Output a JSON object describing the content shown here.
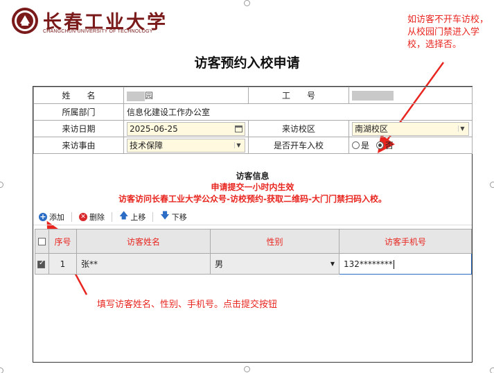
{
  "header": {
    "logo_cn": "长春工业大学",
    "logo_en": "CHANGCHUN UNIVERSITY OF TECHNOLOGY",
    "brand_color": "#7a1a1a"
  },
  "page_title": "访客预约入校申请",
  "annotations": {
    "top_note": "如访客不开车访校，从校园门禁进入学校，选择否。",
    "bottom_note": "填写访客姓名、性别、手机号。点击提交按钮",
    "color": "#e8251f"
  },
  "form": {
    "name_label": "姓　　名",
    "name_value_tail": "园",
    "id_label": "工　　号",
    "dept_label": "所属部门",
    "dept_value": "信息化建设工作办公室",
    "date_label": "来访日期",
    "date_value": "2025-06-25",
    "campus_label": "来访校区",
    "campus_value": "南湖校区",
    "reason_label": "来访事由",
    "reason_value": "技术保障",
    "car_label": "是否开车入校",
    "car_options": {
      "yes": "是",
      "no": "否"
    },
    "car_selected": "no",
    "input_bg": "#fff9e0"
  },
  "info": {
    "title": "访客信息",
    "line1": "申请提交一小时内生效",
    "line2": "访客访问长春工业大学公众号-访校预约-获取二维码-大门门禁扫码入校。"
  },
  "toolbar": {
    "add": "添加",
    "delete": "删除",
    "move_up": "上移",
    "move_down": "下移",
    "icons": {
      "add": "plus-circle-icon",
      "delete": "x-circle-icon",
      "up": "arrow-up-icon",
      "down": "arrow-down-icon"
    }
  },
  "grid": {
    "headers": {
      "index": "序号",
      "name": "访客姓名",
      "gender": "性别",
      "phone": "访客手机号"
    },
    "header_color": "#e8251f",
    "rows": [
      {
        "checked": true,
        "index": "1",
        "name": "张**",
        "gender": "男",
        "phone": "132********"
      }
    ]
  }
}
